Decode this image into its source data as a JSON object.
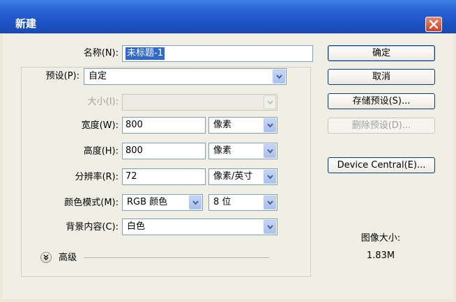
{
  "window": {
    "title": "新建"
  },
  "form": {
    "name_label": "名称(N):",
    "name_value": "未标题-1",
    "preset_label": "预设(P):",
    "preset_value": "自定",
    "size_label": "大小(I):",
    "size_value": "",
    "width_label": "宽度(W):",
    "width_value": "800",
    "width_unit": "像素",
    "height_label": "高度(H):",
    "height_value": "800",
    "height_unit": "像素",
    "resolution_label": "分辨率(R):",
    "resolution_value": "72",
    "resolution_unit": "像素/英寸",
    "color_mode_label": "颜色模式(M):",
    "color_mode_value": "RGB 颜色",
    "bit_depth_value": "8 位",
    "background_label": "背景内容(C):",
    "background_value": "白色",
    "advanced_label": "高级"
  },
  "buttons": {
    "ok": "确定",
    "cancel": "取消",
    "save_preset": "存储预设(S)...",
    "delete_preset": "删除预设(D)...",
    "device_central": "Device Central(E)..."
  },
  "image_size": {
    "label": "图像大小:",
    "value": "1.83M"
  },
  "colors": {
    "titlebar": "#2a63d4",
    "selection": "#316ac5",
    "close_button": "#d0502e"
  }
}
